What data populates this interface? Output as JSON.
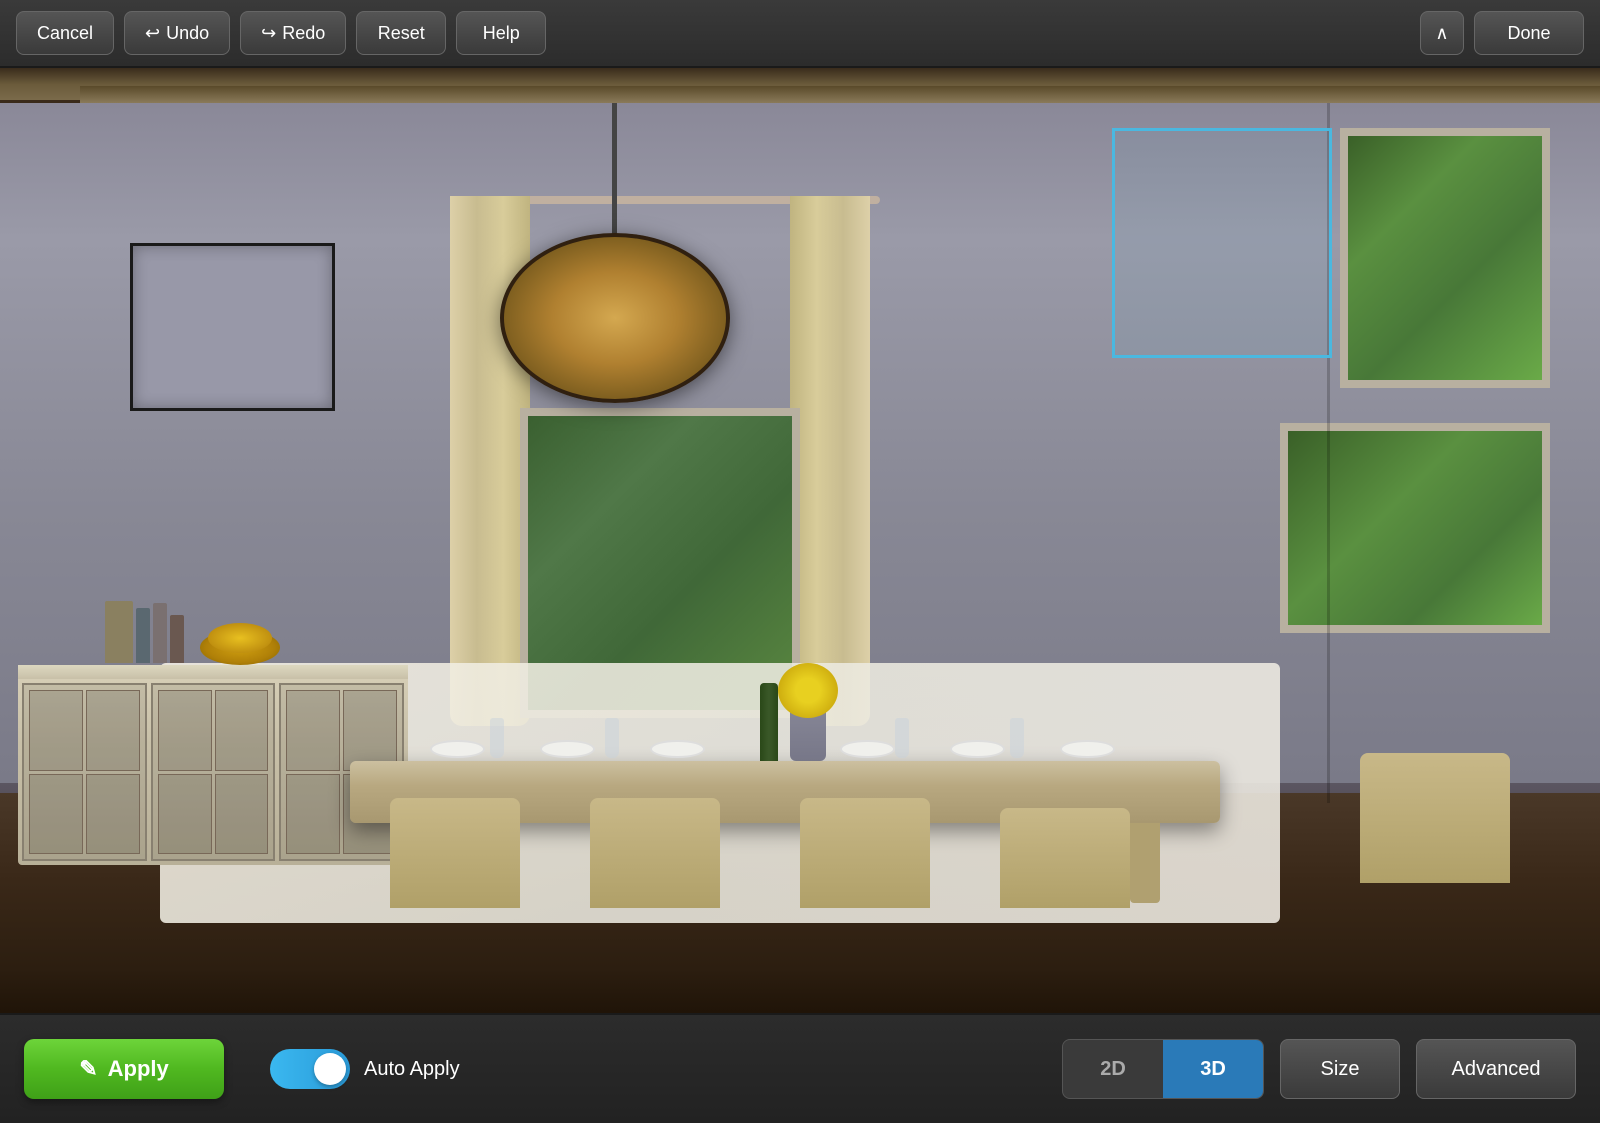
{
  "toolbar": {
    "cancel_label": "Cancel",
    "undo_label": "Undo",
    "redo_label": "Redo",
    "reset_label": "Reset",
    "help_label": "Help",
    "done_label": "Done",
    "chevron_symbol": "∧"
  },
  "bottom_bar": {
    "apply_label": "Apply",
    "apply_icon": "✎",
    "auto_apply_label": "Auto Apply",
    "view_2d_label": "2D",
    "view_3d_label": "3D",
    "size_label": "Size",
    "advanced_label": "Advanced"
  },
  "scene": {
    "has_selection_box": true,
    "selection_box_color": "#4ab8e0"
  },
  "colors": {
    "toolbar_bg": "#2c2c2c",
    "apply_green": "#50b820",
    "toggle_blue": "#3ab8f0",
    "view_active": "#2a7ab8",
    "selection_border": "#4ab8e0"
  }
}
